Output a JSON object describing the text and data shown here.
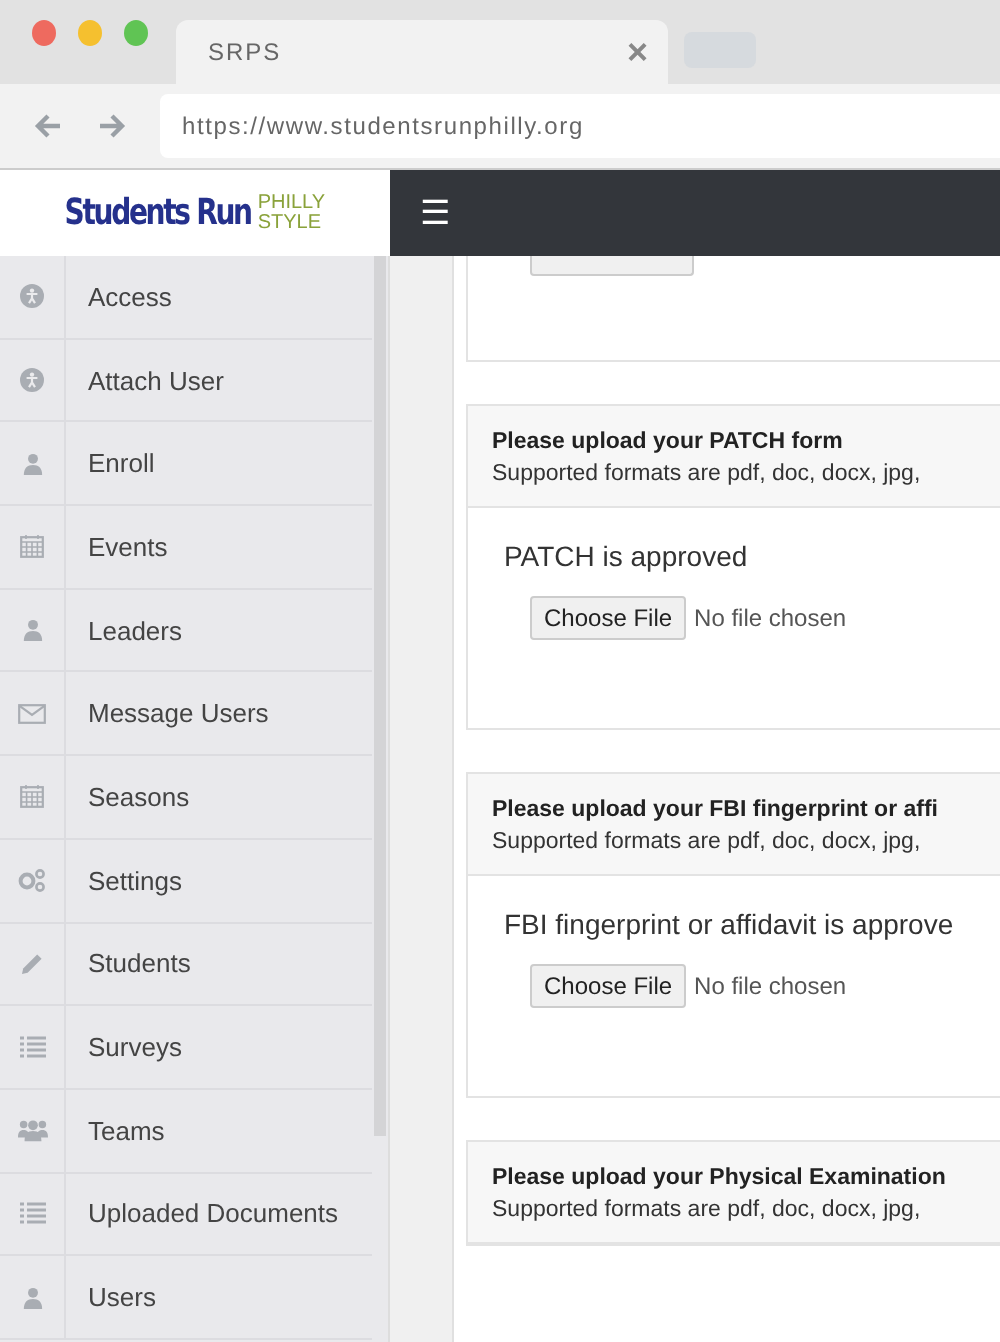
{
  "browser": {
    "tab_title": "SRPS",
    "tab_close": "×",
    "url": "https://www.studentsrunphilly.org"
  },
  "logo": {
    "main": "Students Run",
    "side_top": "PHILLY",
    "side_bottom": "STYLE"
  },
  "navbar": {
    "menu": "☰"
  },
  "sidebar": {
    "items": [
      {
        "label": "Access",
        "kind": "access"
      },
      {
        "label": "Attach User",
        "kind": "access"
      },
      {
        "label": "Enroll",
        "kind": "person"
      },
      {
        "label": "Events",
        "kind": "calendar"
      },
      {
        "label": "Leaders",
        "kind": "person"
      },
      {
        "label": "Message Users",
        "kind": "envelope"
      },
      {
        "label": "Seasons",
        "kind": "calendar"
      },
      {
        "label": "Settings",
        "kind": "gears"
      },
      {
        "label": "Students",
        "kind": "pencil"
      },
      {
        "label": "Surveys",
        "kind": "list"
      },
      {
        "label": "Teams",
        "kind": "group"
      },
      {
        "label": "Uploaded Documents",
        "kind": "list"
      },
      {
        "label": "Users",
        "kind": "person"
      }
    ]
  },
  "cards": [
    {
      "kind": "partial"
    },
    {
      "kind": "upload",
      "heading": "Please upload your PATCH form",
      "formats": "Supported formats are pdf, doc, docx, jpg,",
      "status": "PATCH is approved",
      "file_button": "Choose File",
      "file_status": "No file chosen"
    },
    {
      "kind": "upload",
      "heading": "Please upload your FBI fingerprint or affi",
      "formats": "Supported formats are pdf, doc, docx, jpg,",
      "status": "FBI fingerprint or affidavit is approve",
      "file_button": "Choose File",
      "file_status": "No file chosen"
    },
    {
      "kind": "upload",
      "heading": "Please upload your Physical Examination",
      "formats": "Supported formats are pdf, doc, docx, jpg,"
    }
  ]
}
